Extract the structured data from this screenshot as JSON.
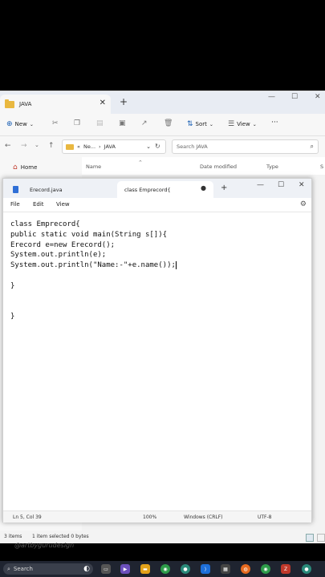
{
  "explorer": {
    "tab_title": "JAVA",
    "new_label": "New",
    "sort_label": "Sort",
    "view_label": "View",
    "more_label": "···",
    "address_prefix": "«",
    "address_crumb1": "Ne...",
    "address_crumb_sep": "›",
    "address_crumb2": "JAVA",
    "search_placeholder": "Search JAVA",
    "nav_home": "Home",
    "col_name": "Name",
    "col_date": "Date modified",
    "col_type": "Type",
    "col_size": "S",
    "status_items": "3 items",
    "status_selected": "1 item selected  0 bytes"
  },
  "notepad": {
    "tab_inactive": "Erecord.java",
    "tab_active": "class Emprecord{",
    "menu": [
      "File",
      "Edit",
      "View"
    ],
    "code_lines": [
      "class Emprecord{",
      "public static void main(String s[]){",
      "Erecord e=new Erecord();",
      "System.out.println(e);",
      "System.out.println(\"Name:-\"+e.name());",
      "",
      "}",
      "",
      "",
      "}"
    ],
    "status": {
      "position": "Ln 5, Col 39",
      "zoom": "100%",
      "line_ending": "Windows (CRLF)",
      "encoding": "UTF-8"
    }
  },
  "watermark": "@artbygurudesign",
  "taskbar": {
    "search_label": "Search"
  },
  "colors": {
    "accent": "#1a5fb4",
    "folder": "#e9b840",
    "taskbar": "#1f2430"
  }
}
